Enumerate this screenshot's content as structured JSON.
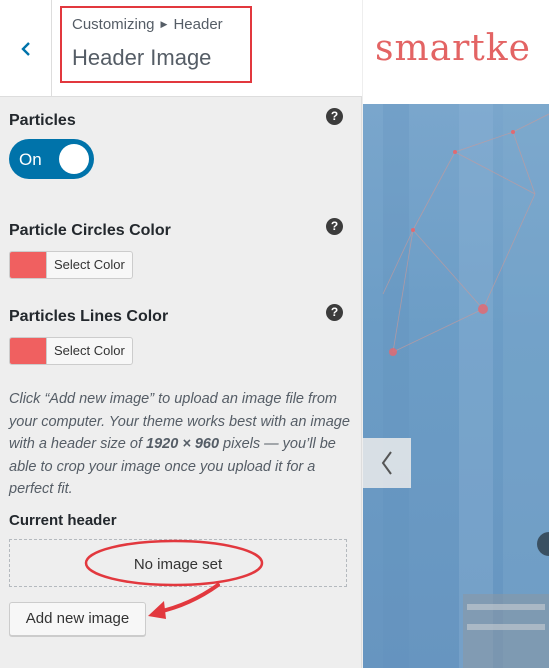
{
  "customizer": {
    "breadcrumb_parent": "Customizing",
    "breadcrumb_section": "Header",
    "section_title": "Header Image",
    "controls": {
      "particles": {
        "label": "Particles",
        "toggle_state": "On",
        "help": "?"
      },
      "circles_color": {
        "label": "Particle Circles Color",
        "button_label": "Select Color",
        "swatch_color": "#f06060",
        "help": "?"
      },
      "lines_color": {
        "label": "Particles Lines Color",
        "button_label": "Select Color",
        "swatch_color": "#f06060",
        "help": "?"
      }
    },
    "description": {
      "part1": "Click “Add new image” to upload an image file from your computer. Your theme works best with an image with a header size of ",
      "size": "1920 × 960",
      "part2": " pixels — you’ll be able to crop your image once you upload it for a perfect fit."
    },
    "current_header": {
      "label": "Current header",
      "placeholder": "No image set"
    },
    "add_button": "Add new image"
  },
  "preview": {
    "site_title": "smartke",
    "brand_color": "#e36464"
  },
  "annotation_color": "#e2383e",
  "icons": [
    "chevron-left-icon",
    "help-icon",
    "arrow-annotation",
    "ellipse-annotation",
    "slider-prev-icon"
  ]
}
